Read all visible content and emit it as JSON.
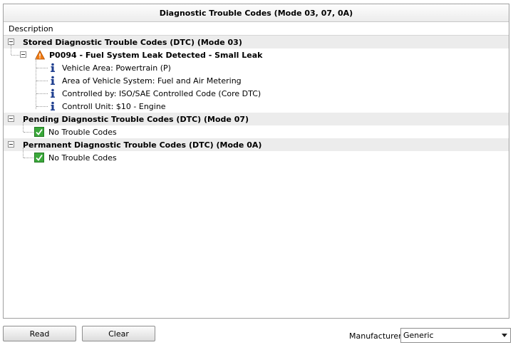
{
  "title": "Diagnostic Trouble Codes (Mode 03, 07, 0A)",
  "column_header": "Description",
  "tree": {
    "stored": {
      "label": "Stored Diagnostic Trouble Codes (DTC) (Mode 03)",
      "code": {
        "label": "P0094 - Fuel System Leak Detected - Small Leak",
        "details": [
          "Vehicle Area: Powertrain (P)",
          "Area of Vehicle System: Fuel and Air Metering",
          "Controlled by: ISO/SAE Controlled Code (Core DTC)",
          "Controll Unit: $10 - Engine"
        ]
      }
    },
    "pending": {
      "label": "Pending Diagnostic Trouble Codes (DTC) (Mode 07)",
      "item": "No Trouble Codes"
    },
    "permanent": {
      "label": "Permanent Diagnostic Trouble Codes (DTC) (Mode 0A)",
      "item": "No Trouble Codes"
    }
  },
  "buttons": {
    "read": "Read",
    "clear": "Clear"
  },
  "manufacturer": {
    "label": "Manufacturer",
    "selected": "Generic"
  },
  "icons": {
    "warning": "warning-triangle-icon",
    "info": "info-icon",
    "ok": "ok-check-icon"
  },
  "colors": {
    "warning": "#f07a10",
    "info": "#1f3f8f",
    "ok": "#3aa83a",
    "group_bg": "#ececec"
  }
}
